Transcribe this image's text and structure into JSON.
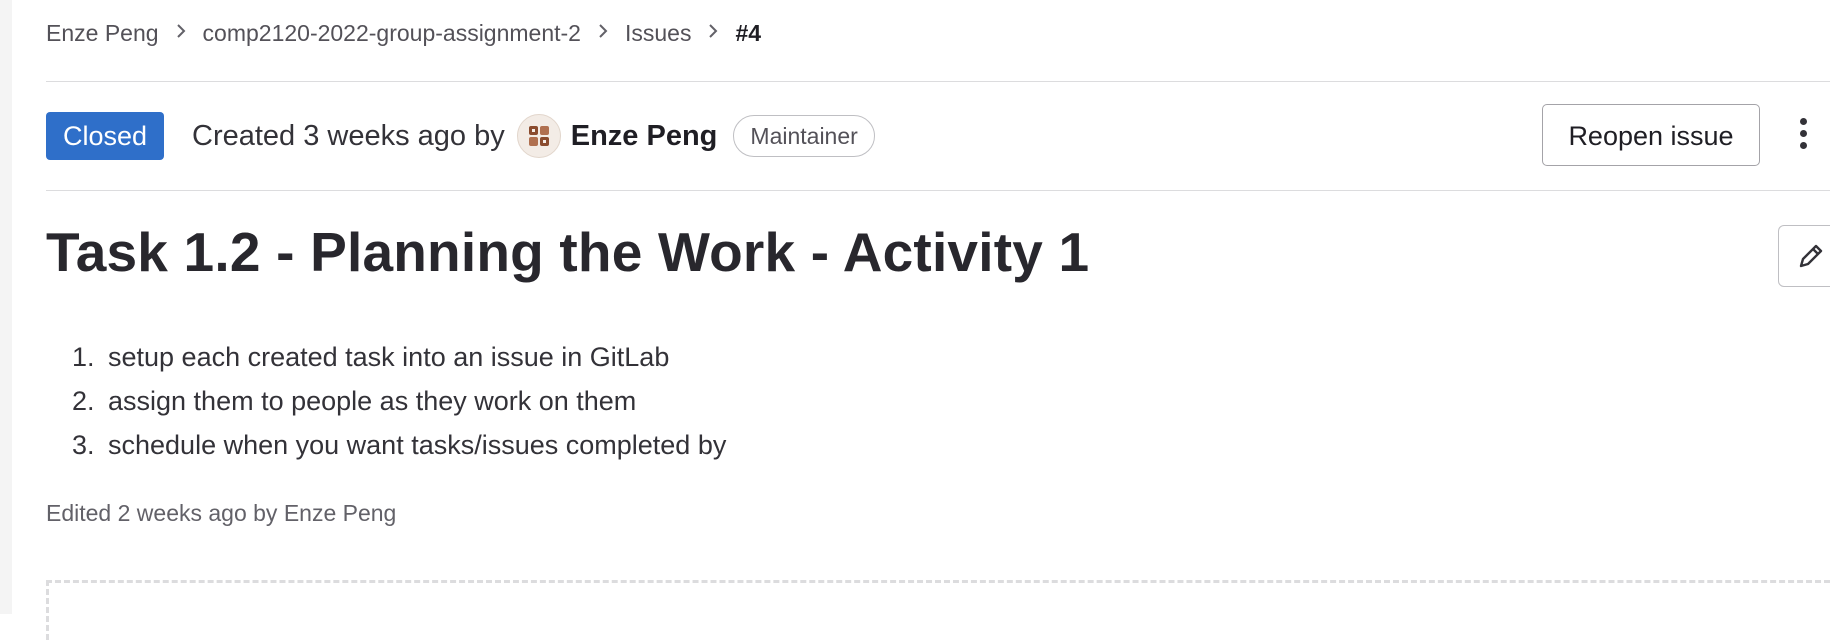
{
  "breadcrumb": {
    "items": [
      "Enze Peng",
      "comp2120-2022-group-assignment-2",
      "Issues"
    ],
    "current": "#4",
    "separator_icon": "chevron-right-icon"
  },
  "header": {
    "status": "Closed",
    "created_prefix": "Created 3 weeks ago by",
    "author": "Enze Peng",
    "role": "Maintainer",
    "reopen_label": "Reopen issue",
    "more_actions_icon": "kebab-vertical-icon"
  },
  "issue": {
    "title": "Task 1.2 - Planning the Work - Activity 1",
    "edit_icon": "pencil-icon",
    "description_items": [
      "setup each created task into an issue in GitLab",
      "assign them to people as they work on them",
      "schedule when you want tasks/issues completed by"
    ],
    "edited_note": "Edited 2 weeks ago by Enze Peng"
  },
  "colors": {
    "status_closed_bg": "#2f6fc9",
    "text_primary": "#333238",
    "border": "#dcdcde"
  }
}
